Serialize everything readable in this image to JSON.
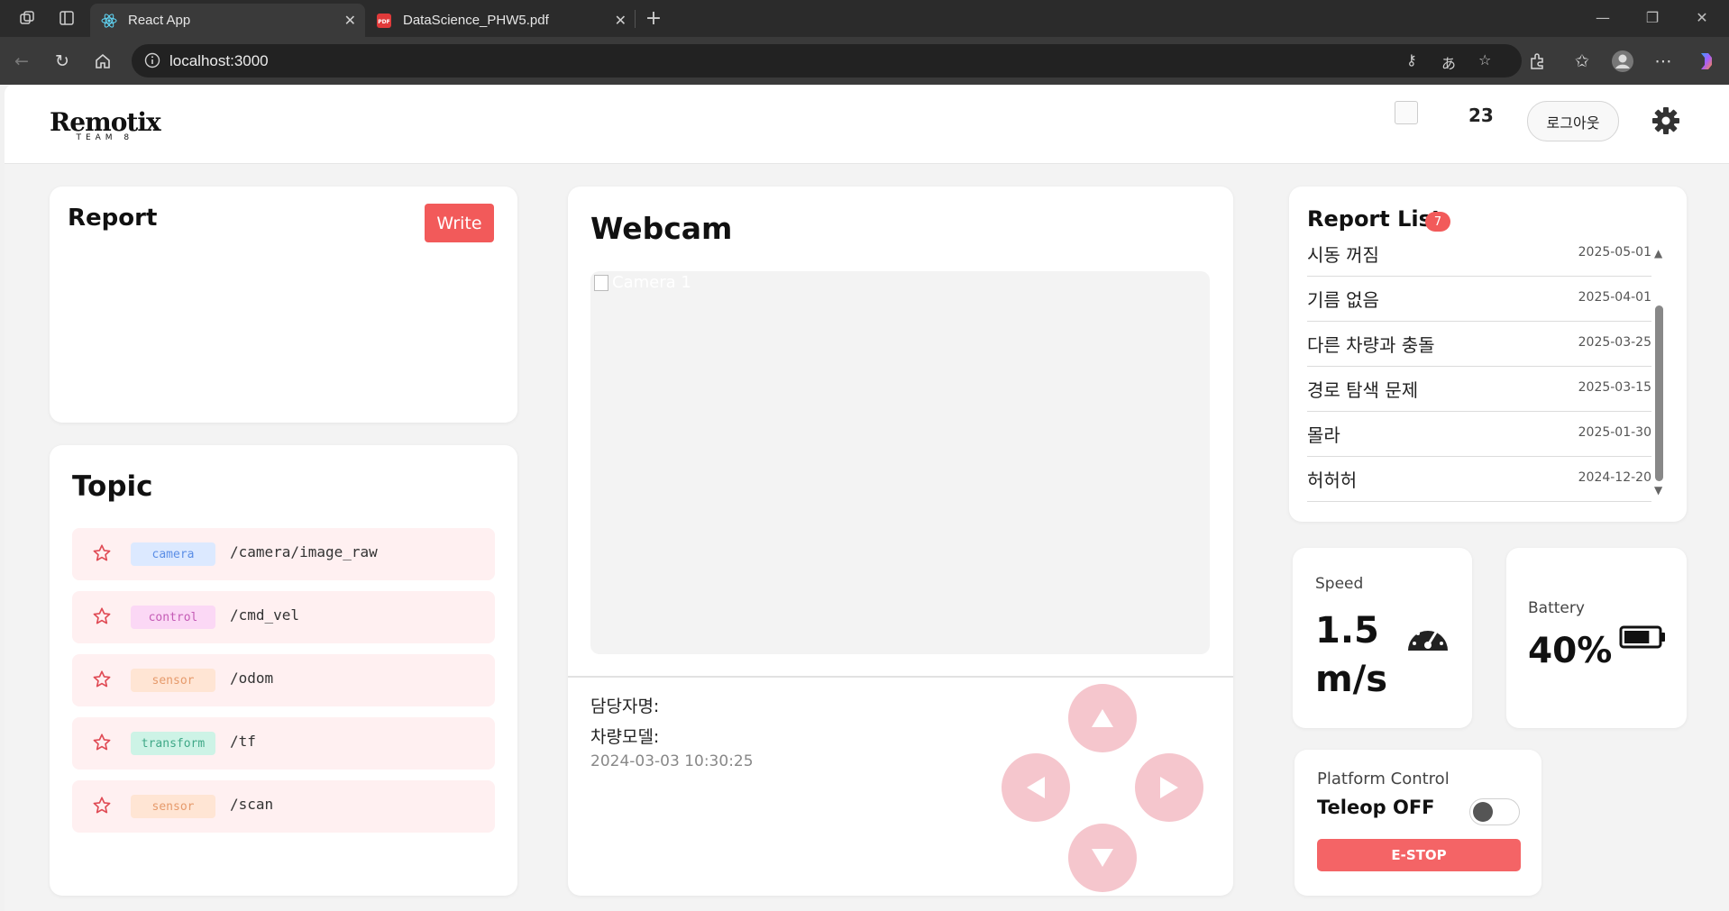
{
  "browser": {
    "tabs": [
      {
        "title": "React App",
        "active": true
      },
      {
        "title": "DataScience_PHW5.pdf",
        "active": false
      }
    ],
    "url": "localhost:3000"
  },
  "header": {
    "logo_main": "Remotix",
    "logo_sub": "TEAM 8",
    "count": "23",
    "logout_label": "로그아웃"
  },
  "report": {
    "title": "Report",
    "write_label": "Write"
  },
  "topic": {
    "title": "Topic",
    "items": [
      {
        "tag": "camera",
        "path": "/camera/image_raw",
        "tag_bg": "#dce9ff",
        "tag_color": "#5b8ee6"
      },
      {
        "tag": "control",
        "path": "/cmd_vel",
        "tag_bg": "#fbd8f5",
        "tag_color": "#c45bb5"
      },
      {
        "tag": "sensor",
        "path": "/odom",
        "tag_bg": "#ffe5d4",
        "tag_color": "#e69a6b"
      },
      {
        "tag": "transform",
        "path": "/tf",
        "tag_bg": "#cdf3e6",
        "tag_color": "#3fa887"
      },
      {
        "tag": "sensor",
        "path": "/scan",
        "tag_bg": "#ffe5d4",
        "tag_color": "#e69a6b"
      }
    ]
  },
  "webcam": {
    "title": "Webcam",
    "camera_alt": "Camera 1",
    "manager_label": "담당자명:",
    "model_label": "차량모델:",
    "timestamp": "2024-03-03 10:30:25"
  },
  "report_list": {
    "title": "Report List",
    "count": "7",
    "items": [
      {
        "title": "시동 꺼짐",
        "date": "2025-05-01"
      },
      {
        "title": "기름 없음",
        "date": "2025-04-01"
      },
      {
        "title": "다른 차량과 충돌",
        "date": "2025-03-25"
      },
      {
        "title": "경로 탐색 문제",
        "date": "2025-03-15"
      },
      {
        "title": "몰라",
        "date": "2025-01-30"
      },
      {
        "title": "허허허",
        "date": "2024-12-20"
      }
    ]
  },
  "speed": {
    "label": "Speed",
    "value": "1.5 m/s"
  },
  "battery": {
    "label": "Battery",
    "value": "40%",
    "level": 0.4
  },
  "platform": {
    "label": "Platform Control",
    "teleop_label": "Teleop OFF",
    "teleop_on": false,
    "estop_label": "E-STOP"
  },
  "colors": {
    "accent": "#f25a5a",
    "dpad": "#f5c6cd"
  }
}
